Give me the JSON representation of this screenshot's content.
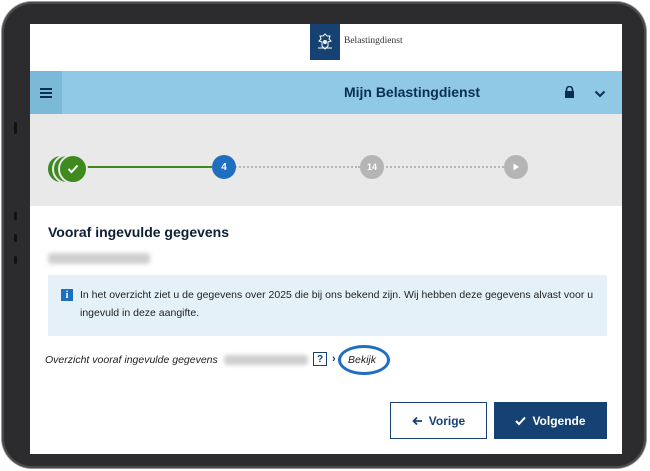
{
  "header": {
    "logo_text": "Belastingdienst"
  },
  "nav": {
    "title": "Mijn Belastingdienst"
  },
  "stepper": {
    "current_step": "4",
    "step_14": "14"
  },
  "page": {
    "title": "Vooraf ingevulde gegevens",
    "info_text": "In het overzicht ziet u de gegevens over 2025 die bij ons bekend zijn. Wij hebben deze gegevens alvast voor u ingevuld in deze aangifte.",
    "overview_label": "Overzicht vooraf ingevulde gegevens",
    "help_label": "?",
    "view_label": "Bekijk"
  },
  "buttons": {
    "prev": "Vorige",
    "next": "Volgende"
  },
  "colors": {
    "brand": "#154273",
    "nav": "#8fc9e6",
    "done": "#3e8a1f",
    "active": "#1f6fc0",
    "future": "#b5b5b5"
  }
}
